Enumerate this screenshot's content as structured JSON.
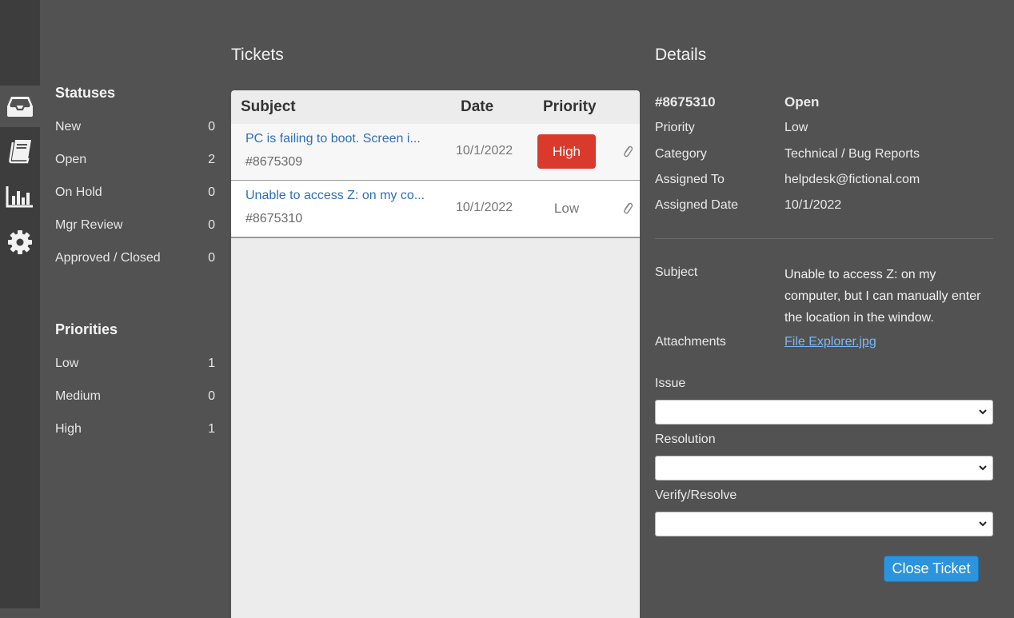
{
  "rail": {
    "items": [
      {
        "icon": "inbox-icon",
        "active": true
      },
      {
        "icon": "book-icon",
        "active": false
      },
      {
        "icon": "bar-chart-icon",
        "active": false
      },
      {
        "icon": "gear-icon",
        "active": false
      }
    ]
  },
  "filters": {
    "statuses_title": "Statuses",
    "statuses": [
      {
        "label": "New",
        "count": "0"
      },
      {
        "label": "Open",
        "count": "2"
      },
      {
        "label": "On Hold",
        "count": "0"
      },
      {
        "label": "Mgr Review",
        "count": "0"
      },
      {
        "label": "Approved / Closed",
        "count": "0"
      }
    ],
    "priorities_title": "Priorities",
    "priorities": [
      {
        "label": "Low",
        "count": "1"
      },
      {
        "label": "Medium",
        "count": "0"
      },
      {
        "label": "High",
        "count": "1"
      }
    ]
  },
  "tickets": {
    "title": "Tickets",
    "columns": {
      "subject": "Subject",
      "date": "Date",
      "priority": "Priority"
    },
    "rows": [
      {
        "subject": "PC is failing to boot. Screen i...",
        "number": "#8675309",
        "date": "10/1/2022",
        "priority": "High"
      },
      {
        "subject": "Unable to access Z: on my co...",
        "number": "#8675310",
        "date": "10/1/2022",
        "priority": "Low"
      }
    ]
  },
  "details": {
    "title": "Details",
    "ticket_number": "#8675310",
    "status": "Open",
    "fields": [
      {
        "label": "Priority",
        "value": "Low"
      },
      {
        "label": "Category",
        "value": "Technical / Bug Reports"
      },
      {
        "label": "Assigned To",
        "value": "helpdesk@fictional.com"
      },
      {
        "label": "Assigned Date",
        "value": "10/1/2022"
      }
    ],
    "subject_label": "Subject",
    "subject_value": "Unable to access Z: on my computer, but I can manually enter the location in the window.",
    "attachments_label": "Attachments",
    "attachment_file": "File Explorer.jpg",
    "issue_label": "Issue",
    "issue_value": "",
    "resolution_label": "Resolution",
    "resolution_value": "",
    "verify_label": "Verify/Resolve",
    "verify_value": "",
    "close_button": "Close Ticket"
  },
  "colors": {
    "background": "#525252",
    "rail": "#3d3d3d",
    "high_badge": "#d93a2b",
    "link": "#2f6fb6",
    "button": "#2b94dd"
  }
}
